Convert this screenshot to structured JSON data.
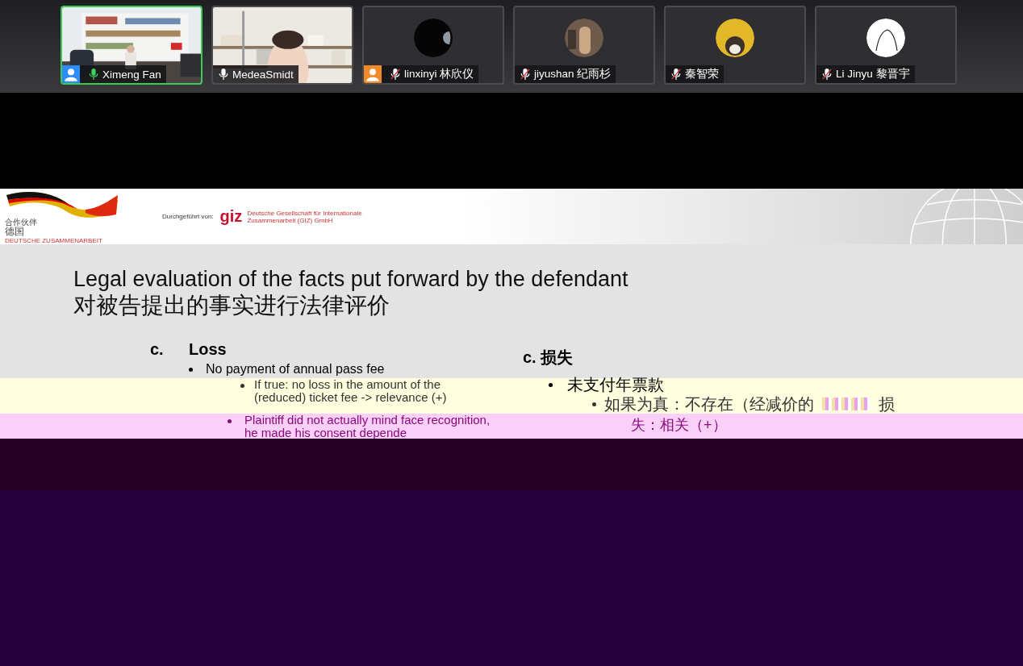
{
  "participants": [
    {
      "name": "Ximeng Fan",
      "kind": "video",
      "muted": false,
      "speaking": true,
      "color": "#2d8cff"
    },
    {
      "name": "MedeaSmidt",
      "kind": "video",
      "muted": false,
      "speaking": false
    },
    {
      "name": "linxinyi 林欣仪",
      "kind": "avatar",
      "muted": true,
      "speaking": false,
      "color": "#f2892b"
    },
    {
      "name": "jiyushan 纪雨杉",
      "kind": "avatar",
      "muted": true,
      "speaking": false
    },
    {
      "name": "秦智荣",
      "kind": "avatar",
      "muted": true,
      "speaking": false
    },
    {
      "name": "Li Jinyu 黎晋宇",
      "kind": "avatar",
      "muted": true,
      "speaking": false
    }
  ],
  "slide": {
    "logo": {
      "line_1": "合作伙伴",
      "line_2": "德国",
      "line_3": "DEUTSCHE ZUSAMMENARBEIT"
    },
    "implemented_by": "Durchgeführt von:",
    "giz": "giz",
    "giz_name": "Deutsche Gesellschaft für Internationale Zusammenarbeit (GIZ) GmbH",
    "title": "Legal evaluation of the facts put forward by the defendant",
    "title_zh": "对被告提出的事实进行法律评价",
    "left": {
      "marker": "c.",
      "heading": "Loss",
      "bullet": "No payment of annual pass fee",
      "sub_lines": [
        "If true: no loss in the amount of the",
        "(reduced) ticket fee -> relevance (+)"
      ],
      "bullet_2_lines": [
        "Plaintiff did not actually mind face recognition,",
        "he made his consent depende"
      ]
    },
    "right": {
      "heading": "c. 损失",
      "bullet": "未支付年票款",
      "sub": "如果为真：不存在（经减价的",
      "sub_end": "损",
      "sub_2": "失：相关（+）"
    }
  }
}
